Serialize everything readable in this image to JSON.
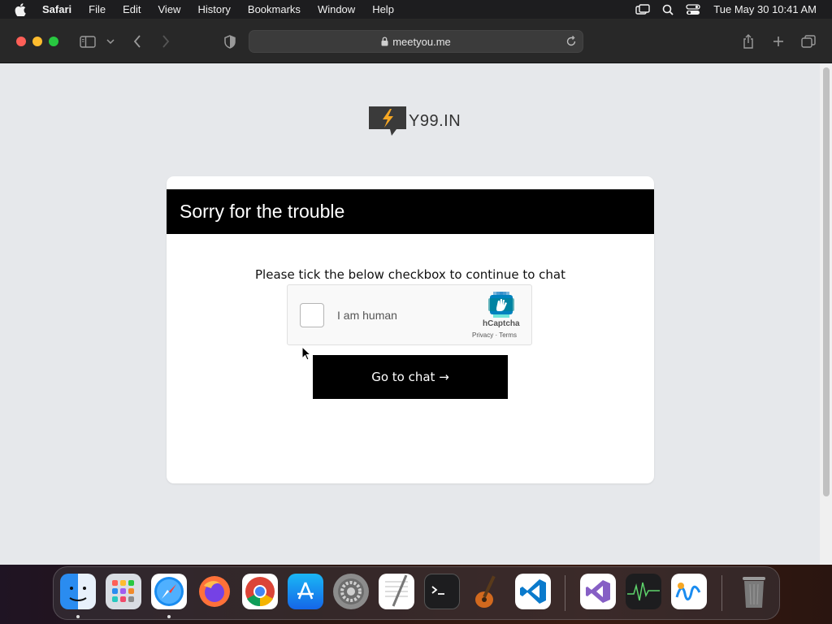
{
  "menubar": {
    "app_name": "Safari",
    "items": [
      "File",
      "Edit",
      "View",
      "History",
      "Bookmarks",
      "Window",
      "Help"
    ],
    "clock": "Tue May 30  10:41 AM",
    "status_icons": [
      "screen-mirror-icon",
      "search-icon",
      "control-center-icon"
    ]
  },
  "browser": {
    "url": "meetyou.me",
    "toolbar_icons": [
      "sidebar-icon",
      "chevron-down-icon",
      "back-icon",
      "forward-icon",
      "privacy-shield-icon",
      "reload-icon",
      "share-icon",
      "new-tab-icon",
      "tab-overview-icon"
    ]
  },
  "page": {
    "logo_text": "Y99.IN",
    "card_title": "Sorry for the trouble",
    "instruction": "Please tick the below checkbox to continue to chat",
    "captcha": {
      "label": "I am human",
      "brand": "hCaptcha",
      "legal": "Privacy · Terms",
      "checked": false
    },
    "go_button": "Go to chat →"
  },
  "dock": {
    "apps": [
      "Finder",
      "Launchpad",
      "Safari",
      "Firefox",
      "Chrome",
      "App Store",
      "System Settings",
      "TextEdit",
      "Terminal",
      "GarageBand",
      "VS Code",
      "Visual Studio",
      "Activity Monitor",
      "Freeform",
      "Trash"
    ]
  },
  "colors": {
    "header_bg": "#000000",
    "page_bg": "#e6e8eb",
    "button_bg": "#000000",
    "logo_bolt": "#f5a623"
  }
}
